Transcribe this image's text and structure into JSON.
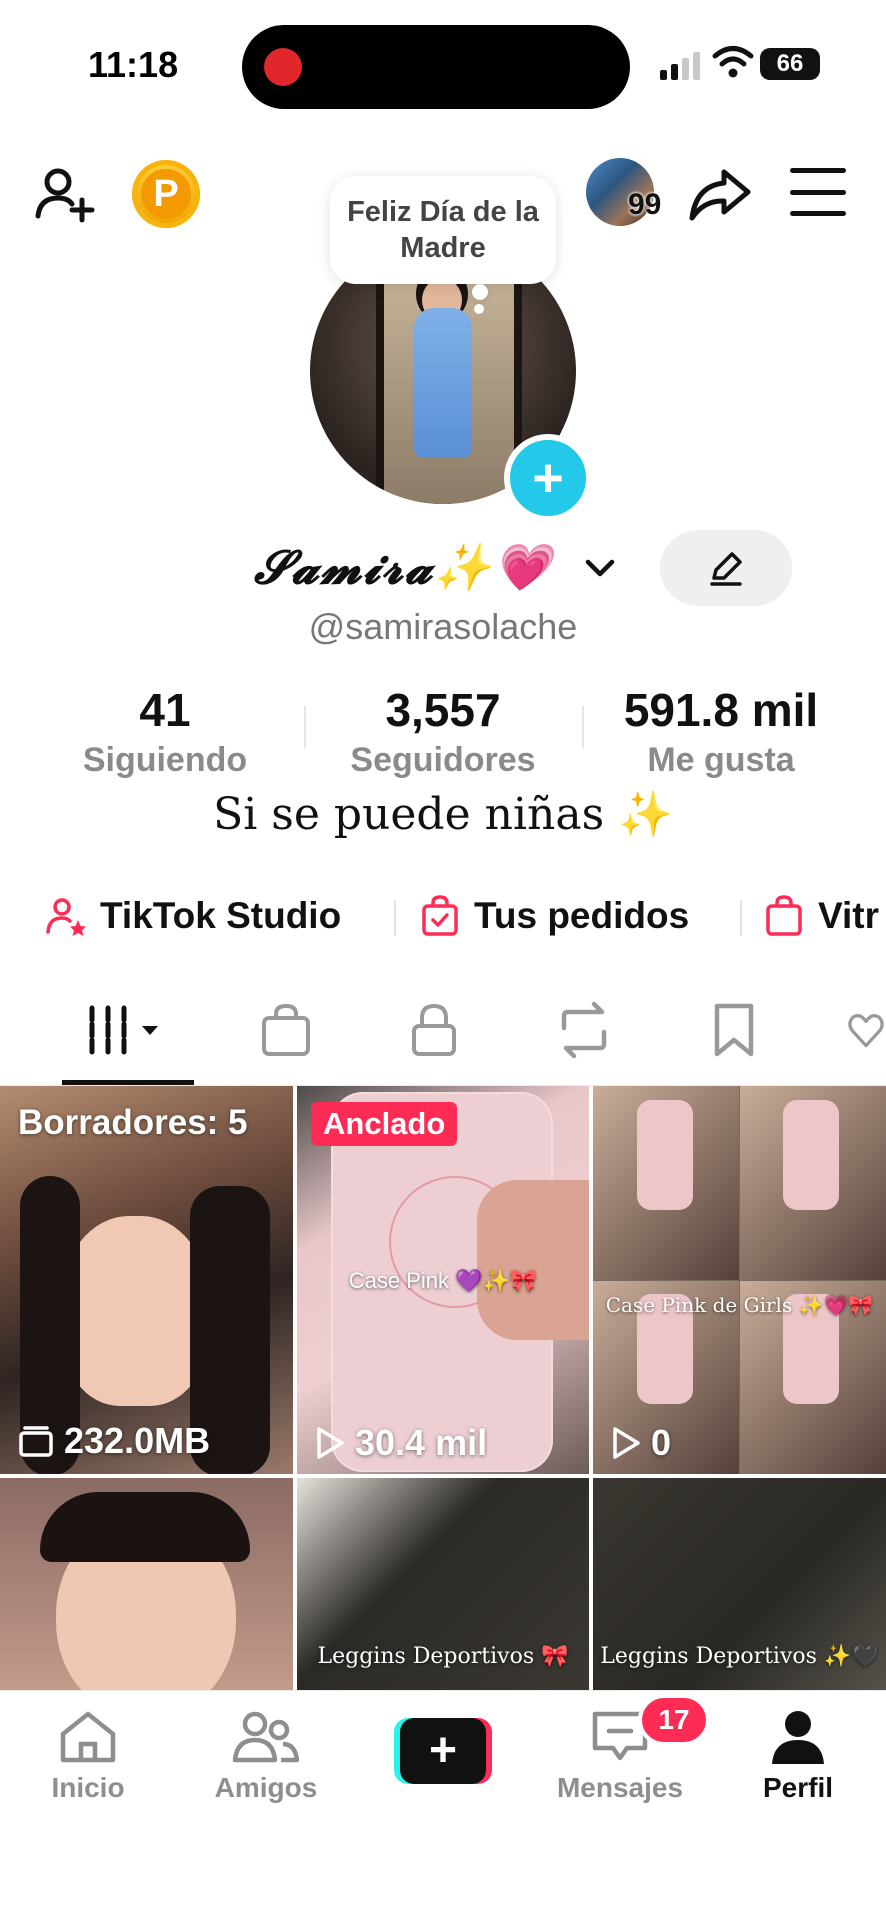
{
  "status_bar": {
    "time": "11:18",
    "battery": "66"
  },
  "header": {
    "visitor_count": "99",
    "coin_letter": "P"
  },
  "profile": {
    "note_bubble": "Feliz Día de la Madre",
    "display_name": "𝓢𝓪𝓶𝓲𝓻𝓪✨💗",
    "username": "@samirasolache",
    "bio": "Si se puede niñas ✨"
  },
  "stats": [
    {
      "value": "41",
      "label": "Siguiendo"
    },
    {
      "value": "3,557",
      "label": "Seguidores"
    },
    {
      "value": "591.8 mil",
      "label": "Me gusta"
    }
  ],
  "quick_links": [
    {
      "label": "TikTok Studio",
      "icon": "person-star-icon"
    },
    {
      "label": "Tus pedidos",
      "icon": "bag-check-icon"
    },
    {
      "label": "Vitr",
      "icon": "bag-icon"
    }
  ],
  "tabs": [
    "videos-grid-icon",
    "shop-bag-icon",
    "lock-icon",
    "repost-icon",
    "bookmark-icon",
    "heart-icon"
  ],
  "grid": [
    {
      "title": "Borradores: 5",
      "stat": "232.0MB",
      "stat_icon": "drafts-icon"
    },
    {
      "pinned": "Anclado",
      "caption": "Case Pink 💜✨🎀",
      "stat": "30.4 mil",
      "stat_icon": "play-icon"
    },
    {
      "caption": "Case Pink de Girls ✨💗🎀",
      "stat": "0",
      "stat_icon": "play-icon"
    },
    {},
    {
      "caption": "Leggins Deportivos 🎀"
    },
    {
      "caption": "Leggins Deportivos ✨🖤"
    }
  ],
  "bottom_nav": [
    {
      "label": "Inicio",
      "icon": "home-icon"
    },
    {
      "label": "Amigos",
      "icon": "friends-icon"
    },
    {
      "label": "",
      "icon": "create-plus-icon"
    },
    {
      "label": "Mensajes",
      "icon": "inbox-icon",
      "badge": "17"
    },
    {
      "label": "Perfil",
      "icon": "profile-icon",
      "active": true
    }
  ],
  "colors": {
    "accent": "#fe2c55",
    "cyan": "#25f4ee",
    "plus_blue": "#24c8e8",
    "coin": "#f7b40d"
  }
}
